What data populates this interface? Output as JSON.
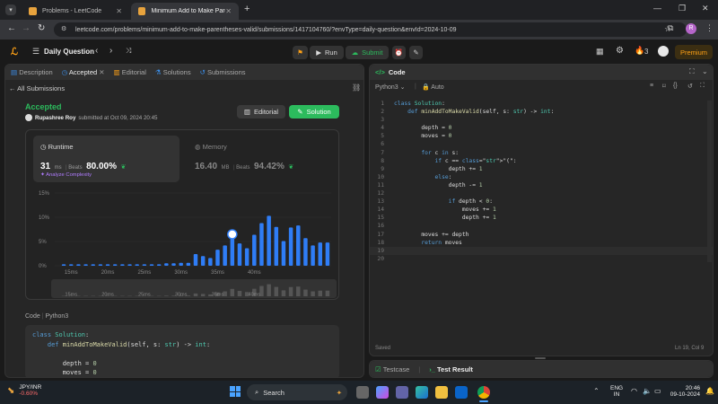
{
  "browser": {
    "tabs": [
      {
        "title": "Problems - LeetCode"
      },
      {
        "title": "Minimum Add to Make Parenth"
      }
    ],
    "url": "leetcode.com/problems/minimum-add-to-make-parentheses-valid/submissions/1417104760/?envType=daily-question&envId=2024-10-09",
    "profile_initial": "R"
  },
  "nav": {
    "title": "Daily Question",
    "run_label": "Run",
    "submit_label": "Submit",
    "streak": "3",
    "premium_label": "Premium"
  },
  "left_tabs": [
    {
      "label": "Description"
    },
    {
      "label": "Accepted"
    },
    {
      "label": "Editorial"
    },
    {
      "label": "Solutions"
    },
    {
      "label": "Submissions"
    }
  ],
  "submission": {
    "back_label": "All Submissions",
    "status": "Accepted",
    "user": "Rupashree Roy",
    "submitted_text": "submitted at Oct 09, 2024 20:45",
    "editorial_label": "Editorial",
    "solution_label": "Solution",
    "runtime_label": "Runtime",
    "runtime_value": "31",
    "runtime_unit": "ms",
    "runtime_beats_label": "Beats",
    "runtime_beats": "80.00%",
    "analyze_label": "Analyze Complexity",
    "memory_label": "Memory",
    "memory_value": "16.40",
    "memory_unit": "MB",
    "memory_beats_label": "Beats",
    "memory_beats": "94.42%",
    "code_tab": "Code",
    "code_lang": "Python3"
  },
  "chart_data": {
    "type": "bar",
    "y_ticks": [
      "15%",
      "10%",
      "5%",
      "0%"
    ],
    "x_ticks": [
      "15ms",
      "20ms",
      "25ms",
      "30ms",
      "35ms",
      "40ms"
    ],
    "ylim": [
      0,
      15
    ],
    "values": [
      0.3,
      0.3,
      0.3,
      0.3,
      0.3,
      0.3,
      0.3,
      0.3,
      0.3,
      0.3,
      0.3,
      0.3,
      0.3,
      0.3,
      0.5,
      0.5,
      0.6,
      0.6,
      2.4,
      2.0,
      1.6,
      3.3,
      4.2,
      6.3,
      4.6,
      3.6,
      6.4,
      8.8,
      10.3,
      8.0,
      5.1,
      7.9,
      8.3,
      5.7,
      4.2,
      4.8,
      4.8
    ],
    "highlight_index": 23,
    "bar_color": "#2f7df6"
  },
  "editor": {
    "title": "Code",
    "lang": "Python3",
    "mode": "Auto",
    "status": "Saved",
    "cursor": "Ln 19, Col 9",
    "lines": [
      "class Solution:",
      "    def minAddToMakeValid(self, s: str) -> int:",
      "",
      "        depth = 0",
      "        moves = 0",
      "",
      "        for c in s:",
      "            if c == \"(\":",
      "                depth += 1",
      "            else:",
      "                depth -= 1",
      "",
      "                if depth < 0:",
      "                    moves += 1",
      "                    depth += 1",
      "",
      "        moves += depth",
      "        return moves",
      "",
      ""
    ],
    "bottom_tabs": [
      {
        "label": "Testcase"
      },
      {
        "label": "Test Result"
      }
    ]
  },
  "snippet_lines": [
    "class Solution:",
    "    def minAddToMakeValid(self, s: str) -> int:",
    "",
    "        depth = 0",
    "        moves = 0"
  ],
  "taskbar": {
    "ticker_name": "JPY/INR",
    "ticker_change": "-0.60%",
    "search_label": "Search",
    "lang1": "ENG",
    "lang2": "IN",
    "time": "20:46",
    "date": "09-10-2024"
  }
}
